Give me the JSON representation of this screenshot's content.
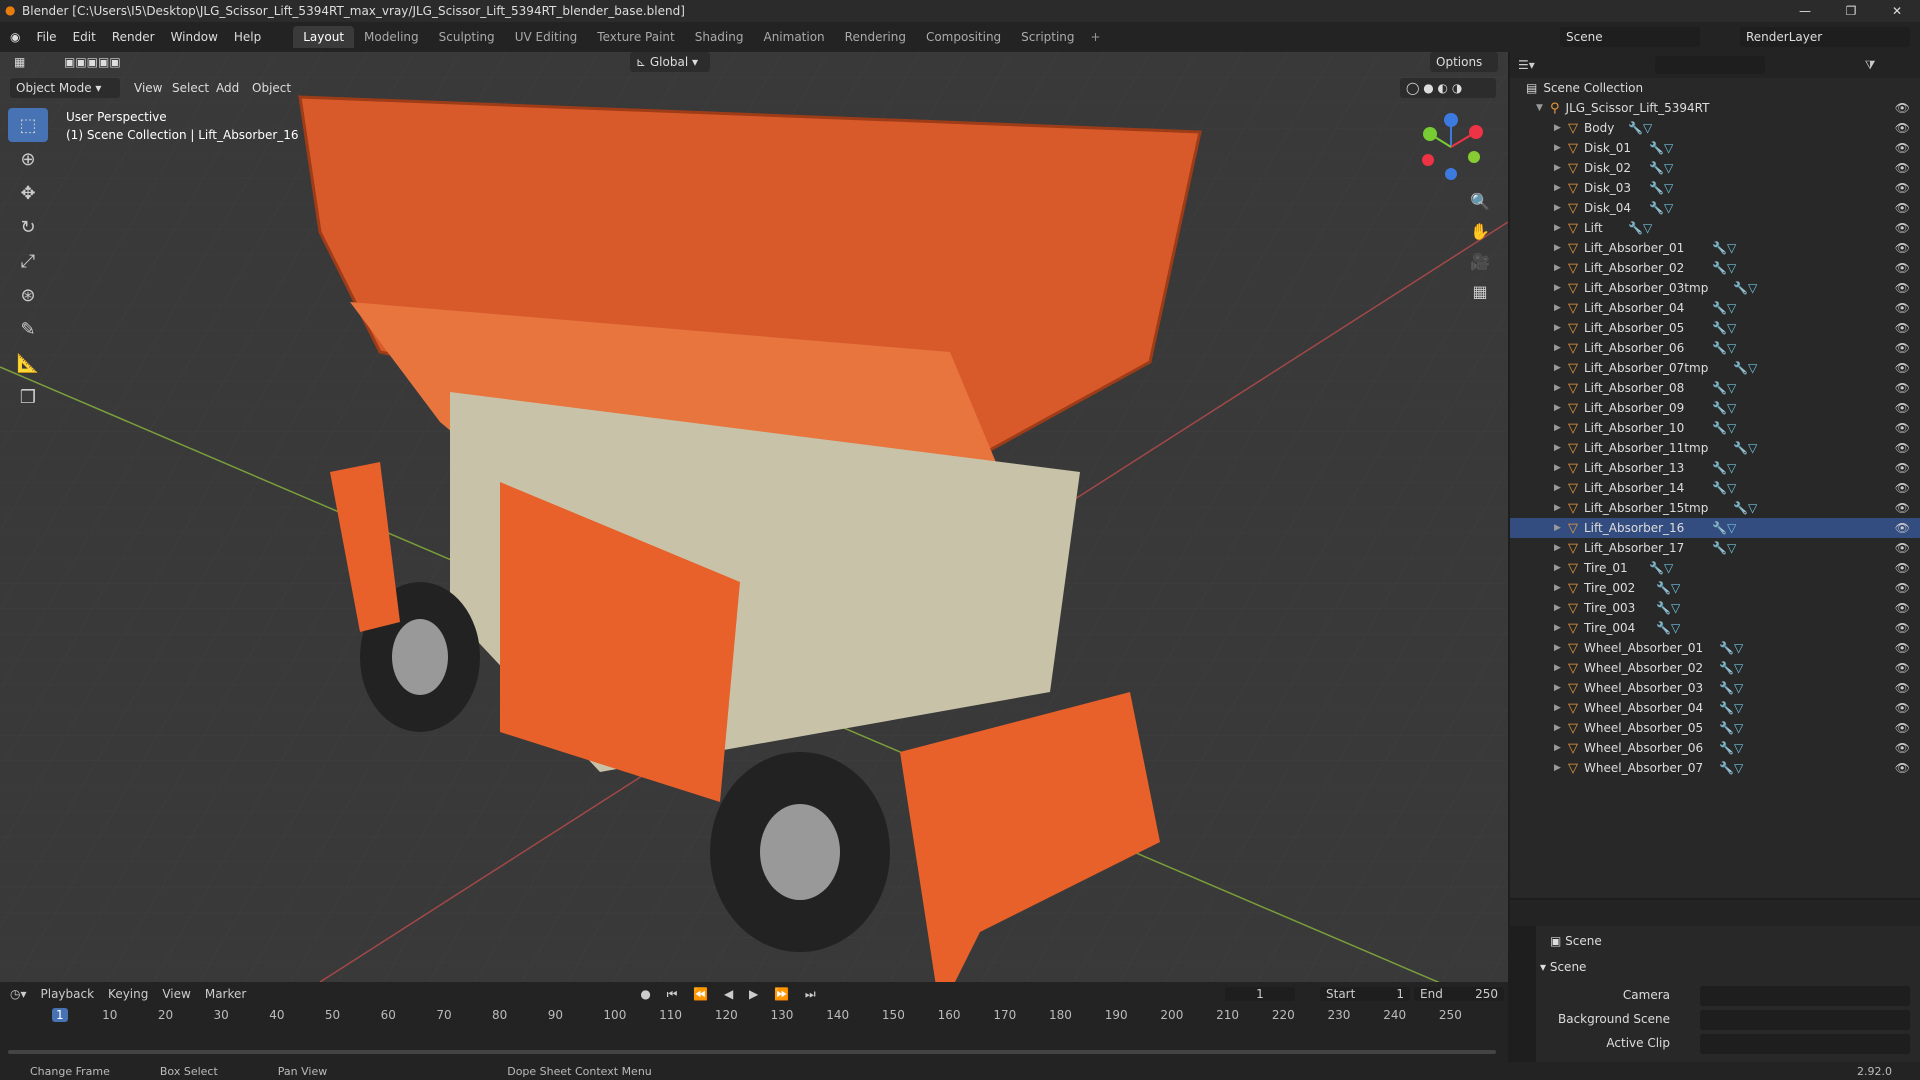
{
  "window": {
    "title": "Blender [C:\\Users\\I5\\Desktop\\JLG_Scissor_Lift_5394RT_max_vray/JLG_Scissor_Lift_5394RT_blender_base.blend]"
  },
  "menubar": {
    "menus": [
      "File",
      "Edit",
      "Render",
      "Window",
      "Help"
    ],
    "workspaces": [
      "Layout",
      "Modeling",
      "Sculpting",
      "UV Editing",
      "Texture Paint",
      "Shading",
      "Animation",
      "Rendering",
      "Compositing",
      "Scripting"
    ],
    "scene": "Scene",
    "render_layer": "RenderLayer"
  },
  "viewport": {
    "mode": "Object Mode",
    "menus": [
      "View",
      "Select",
      "Add",
      "Object"
    ],
    "transform_orientation": "Global",
    "options": "Options",
    "overlay_line1": "User Perspective",
    "overlay_line2": "(1) Scene Collection | Lift_Absorber_16"
  },
  "outliner": {
    "root": "Scene Collection",
    "collection": "JLG_Scissor_Lift_5394RT",
    "items": [
      "Body",
      "Disk_01",
      "Disk_02",
      "Disk_03",
      "Disk_04",
      "Lift",
      "Lift_Absorber_01",
      "Lift_Absorber_02",
      "Lift_Absorber_03tmp",
      "Lift_Absorber_04",
      "Lift_Absorber_05",
      "Lift_Absorber_06",
      "Lift_Absorber_07tmp",
      "Lift_Absorber_08",
      "Lift_Absorber_09",
      "Lift_Absorber_10",
      "Lift_Absorber_11tmp",
      "Lift_Absorber_13",
      "Lift_Absorber_14",
      "Lift_Absorber_15tmp",
      "Lift_Absorber_16",
      "Lift_Absorber_17",
      "Tire_01",
      "Tire_002",
      "Tire_003",
      "Tire_004",
      "Wheel_Absorber_01",
      "Wheel_Absorber_02",
      "Wheel_Absorber_03",
      "Wheel_Absorber_04",
      "Wheel_Absorber_05",
      "Wheel_Absorber_06",
      "Wheel_Absorber_07"
    ]
  },
  "properties": {
    "context": "Scene",
    "panel": "Scene",
    "fields": [
      "Camera",
      "Background Scene",
      "Active Clip"
    ]
  },
  "timeline": {
    "menus": [
      "Playback",
      "Keying",
      "View",
      "Marker"
    ],
    "current_frame": "1",
    "start_label": "Start",
    "start": "1",
    "end_label": "End",
    "end": "250",
    "ticks": [
      "1",
      "10",
      "20",
      "30",
      "40",
      "50",
      "60",
      "70",
      "80",
      "90",
      "100",
      "110",
      "120",
      "130",
      "140",
      "150",
      "160",
      "170",
      "180",
      "190",
      "200",
      "210",
      "220",
      "230",
      "240",
      "250"
    ]
  },
  "statusbar": {
    "items": [
      "Change Frame",
      "Box Select",
      "Pan View",
      "Dope Sheet Context Menu"
    ],
    "version": "2.92.0"
  },
  "colors": {
    "accent": "#4772b3",
    "object": "#e89a3c",
    "lift": "#e8602a"
  }
}
